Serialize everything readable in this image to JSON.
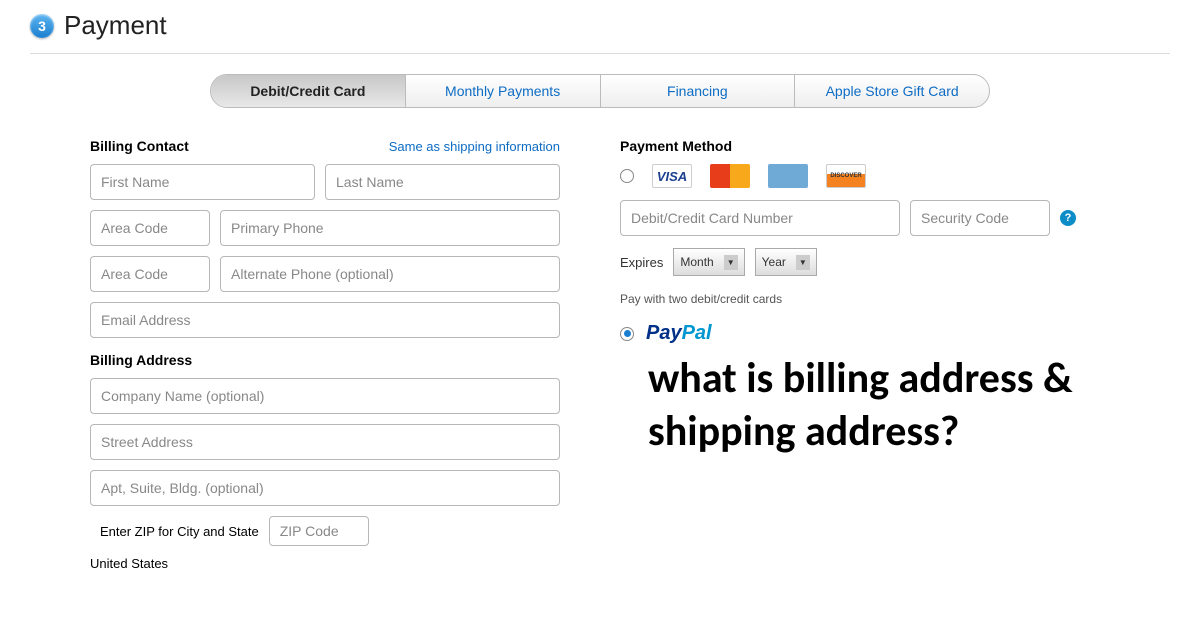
{
  "header": {
    "step_number": "3",
    "title": "Payment"
  },
  "tabs": [
    {
      "label": "Debit/Credit Card",
      "active": true
    },
    {
      "label": "Monthly Payments",
      "active": false
    },
    {
      "label": "Financing",
      "active": false
    },
    {
      "label": "Apple Store Gift Card",
      "active": false
    }
  ],
  "billing_contact": {
    "title": "Billing Contact",
    "same_as_link": "Same as shipping information",
    "first_name_ph": "First Name",
    "last_name_ph": "Last Name",
    "area_code_ph": "Area Code",
    "primary_phone_ph": "Primary Phone",
    "area_code2_ph": "Area Code",
    "alt_phone_ph": "Alternate Phone (optional)",
    "email_ph": "Email Address"
  },
  "billing_address": {
    "title": "Billing Address",
    "company_ph": "Company Name (optional)",
    "street_ph": "Street Address",
    "apt_ph": "Apt, Suite, Bldg. (optional)",
    "zip_label": "Enter ZIP for City and State",
    "zip_ph": "ZIP Code",
    "country": "United States"
  },
  "payment_method": {
    "title": "Payment Method",
    "card_number_ph": "Debit/Credit Card Number",
    "security_code_ph": "Security Code",
    "expires_label": "Expires",
    "month_label": "Month",
    "year_label": "Year",
    "pay_two_link": "Pay with two debit/credit cards",
    "paypal_p1": "Pay",
    "paypal_p2": "Pal"
  },
  "overlay_text": "what is billing address & shipping address?",
  "card_brands": {
    "visa": "VISA",
    "mc": "",
    "amex": "",
    "discover": "DISCOVER"
  }
}
